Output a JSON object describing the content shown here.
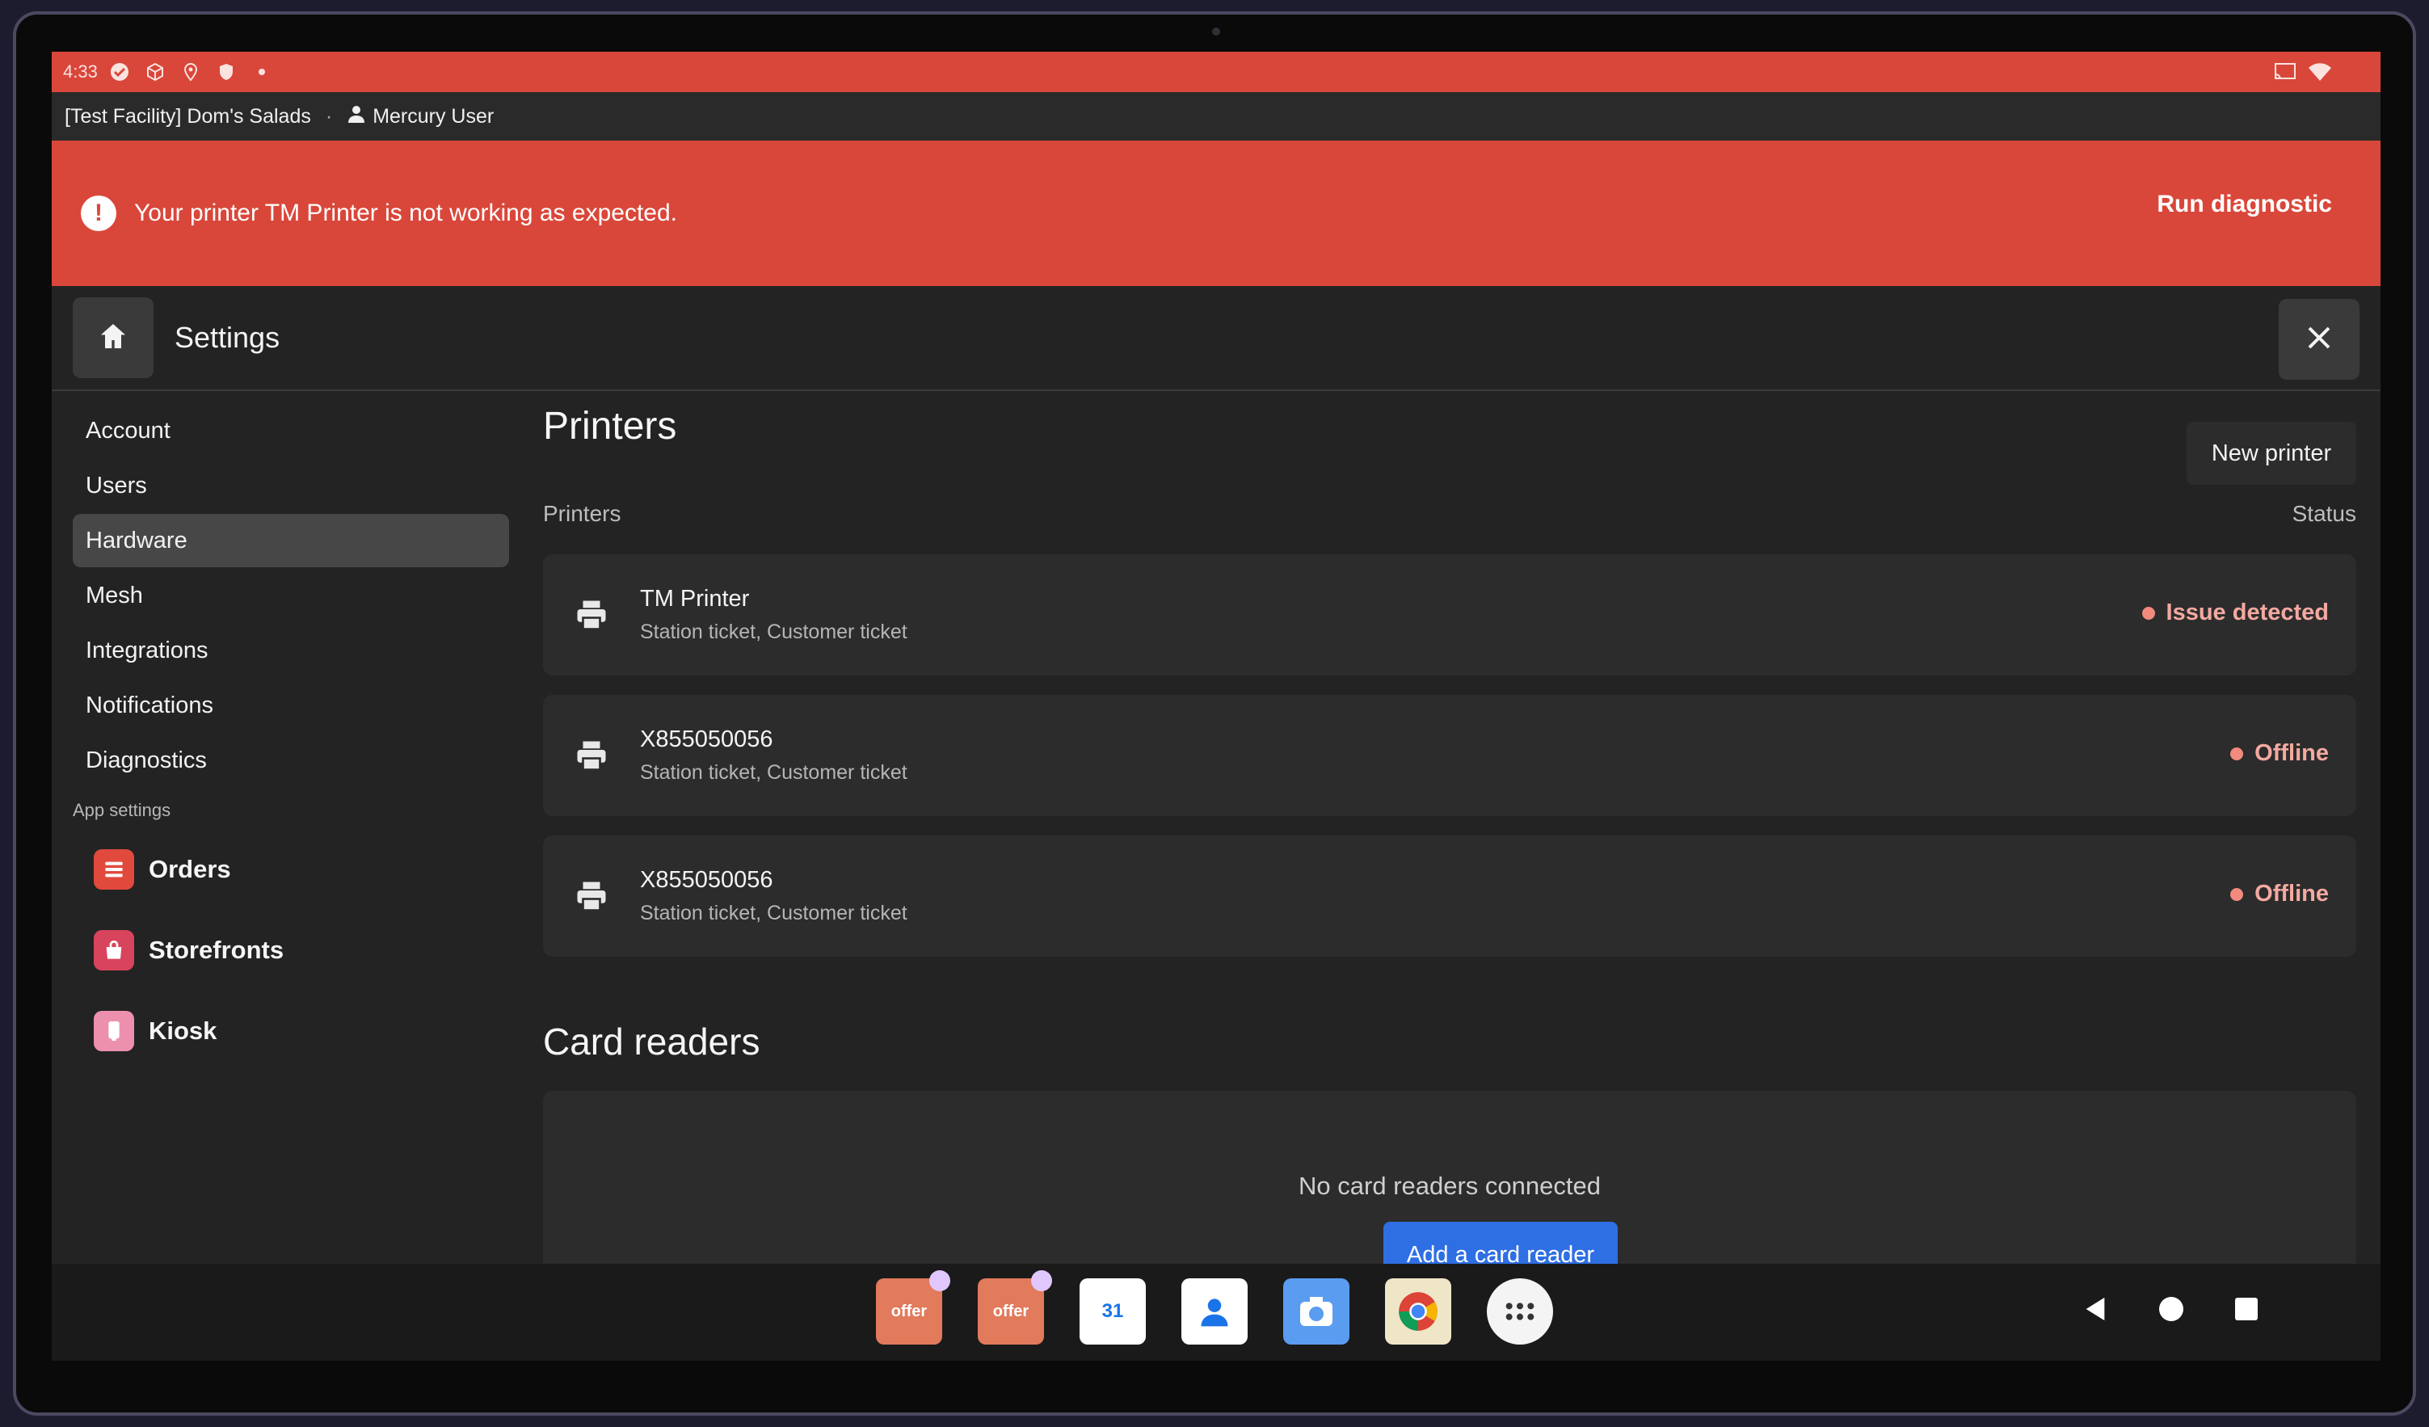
{
  "status_bar": {
    "time": "4:33"
  },
  "facility_bar": {
    "facility": "[Test Facility] Dom's Salads",
    "separator": "·",
    "user": "Mercury User"
  },
  "alert": {
    "message": "Your printer TM Printer is not working as expected.",
    "action": "Run diagnostic"
  },
  "header": {
    "title": "Settings"
  },
  "sidebar": {
    "items": [
      {
        "label": "Account"
      },
      {
        "label": "Users"
      },
      {
        "label": "Hardware",
        "active": true
      },
      {
        "label": "Mesh"
      },
      {
        "label": "Integrations"
      },
      {
        "label": "Notifications"
      },
      {
        "label": "Diagnostics"
      }
    ],
    "section_label": "App settings",
    "apps": [
      {
        "label": "Orders",
        "color": "#e0493c",
        "icon": "orders-icon"
      },
      {
        "label": "Storefronts",
        "color": "#d8445c",
        "icon": "storefronts-icon"
      },
      {
        "label": "Kiosk",
        "color": "#ec90ad",
        "icon": "kiosk-icon"
      }
    ]
  },
  "main": {
    "title": "Printers",
    "new_printer": "New printer",
    "columns": {
      "left": "Printers",
      "right": "Status"
    },
    "printers": [
      {
        "name": "TM Printer",
        "types": "Station ticket, Customer ticket",
        "status": "Issue detected"
      },
      {
        "name": "X855050056",
        "types": "Station ticket, Customer ticket",
        "status": "Offline"
      },
      {
        "name": "X855050056",
        "types": "Station ticket, Customer ticket",
        "status": "Offline"
      }
    ],
    "card_readers_title": "Card readers",
    "card_readers_empty": "No card readers connected",
    "add_card_reader": "Add a card reader"
  },
  "dock": {
    "apps": [
      {
        "label": "offer",
        "icon": "offer-app-icon"
      },
      {
        "label": "offer",
        "icon": "offer-app-icon"
      },
      {
        "label": "31",
        "icon": "calendar-app-icon"
      },
      {
        "icon": "contacts-app-icon"
      },
      {
        "icon": "camera-app-icon"
      },
      {
        "icon": "chrome-app-icon"
      },
      {
        "icon": "app-drawer-icon"
      }
    ]
  },
  "colors": {
    "alert": "#d9473a",
    "primary_button": "#2f6fe4",
    "status_issue": "#f28a7d"
  }
}
